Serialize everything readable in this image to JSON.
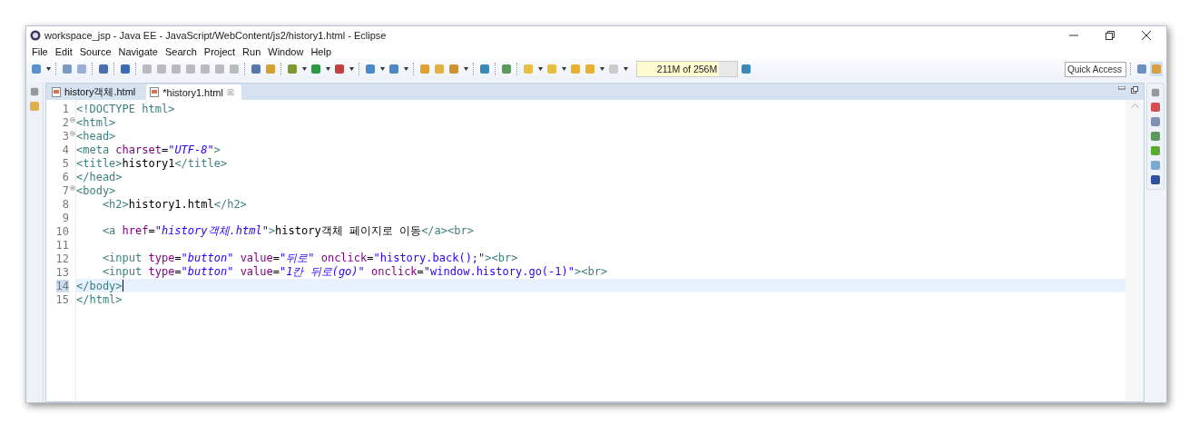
{
  "window": {
    "title": "workspace_jsp - Java EE - JavaScript/WebContent/js2/history1.html - Eclipse"
  },
  "menu": [
    "File",
    "Edit",
    "Source",
    "Navigate",
    "Search",
    "Project",
    "Run",
    "Window",
    "Help"
  ],
  "heap": {
    "reading": "211M of 256M",
    "level": 0.82
  },
  "quick_access": {
    "placeholder": "Quick Access"
  },
  "tabs": [
    {
      "label": "history객체.html",
      "selected": false
    },
    {
      "label": "*history1.html",
      "selected": true,
      "close": "☒"
    }
  ],
  "lines": [
    {
      "number": "1",
      "fold": false,
      "current": false,
      "tokens": [
        {
          "kind": "tag",
          "text": "<!DOCTYPE html>"
        }
      ]
    },
    {
      "number": "2",
      "fold": true,
      "current": false,
      "tokens": [
        {
          "kind": "tag",
          "text": "<html>"
        }
      ]
    },
    {
      "number": "3",
      "fold": true,
      "current": false,
      "tokens": [
        {
          "kind": "tag",
          "text": "<head>"
        }
      ]
    },
    {
      "number": "4",
      "fold": false,
      "current": false,
      "tokens": [
        {
          "kind": "tag",
          "text": "<meta"
        },
        {
          "kind": "attr",
          "text": " charset"
        },
        {
          "kind": "text",
          "text": "="
        },
        {
          "kind": "value",
          "text": "\"UTF-8\""
        },
        {
          "kind": "tag",
          "text": ">"
        }
      ]
    },
    {
      "number": "5",
      "fold": false,
      "current": false,
      "tokens": [
        {
          "kind": "tag",
          "text": "<title>"
        },
        {
          "kind": "text",
          "text": "history1"
        },
        {
          "kind": "tag",
          "text": "</title>"
        }
      ]
    },
    {
      "number": "6",
      "fold": false,
      "current": false,
      "tokens": [
        {
          "kind": "tag",
          "text": "</head>"
        }
      ]
    },
    {
      "number": "7",
      "fold": true,
      "current": false,
      "tokens": [
        {
          "kind": "tag",
          "text": "<body>"
        }
      ]
    },
    {
      "number": "8",
      "fold": false,
      "current": false,
      "tokens": [
        {
          "kind": "tag",
          "text": "    <h2>"
        },
        {
          "kind": "text",
          "text": "history1.html"
        },
        {
          "kind": "tag",
          "text": "</h2>"
        }
      ]
    },
    {
      "number": "9",
      "fold": false,
      "current": false
    },
    {
      "number": "10",
      "fold": false,
      "current": false,
      "tokens": [
        {
          "kind": "tag",
          "text": "    <a"
        },
        {
          "kind": "attr",
          "text": " href"
        },
        {
          "kind": "text",
          "text": "="
        },
        {
          "kind": "value",
          "text": "\"history객체.html\""
        },
        {
          "kind": "tag",
          "text": ">"
        },
        {
          "kind": "text",
          "text": "history객체 페이지로 이동"
        },
        {
          "kind": "tag",
          "text": "</a><br>"
        }
      ]
    },
    {
      "number": "11",
      "fold": false,
      "current": false
    },
    {
      "number": "12",
      "fold": false,
      "current": false,
      "tokens": [
        {
          "kind": "tag",
          "text": "    <input"
        },
        {
          "kind": "attr",
          "text": " type"
        },
        {
          "kind": "text",
          "text": "="
        },
        {
          "kind": "value",
          "text": "\"button\""
        },
        {
          "kind": "attr",
          "text": " value"
        },
        {
          "kind": "text",
          "text": "="
        },
        {
          "kind": "value",
          "text": "\"뒤로\""
        },
        {
          "kind": "attr",
          "text": " onclick"
        },
        {
          "kind": "text",
          "text": "="
        },
        {
          "kind": "script",
          "text": "\"history.back();\""
        },
        {
          "kind": "tag",
          "text": "><br>"
        }
      ]
    },
    {
      "number": "13",
      "fold": false,
      "current": false,
      "tokens": [
        {
          "kind": "tag",
          "text": "    <input"
        },
        {
          "kind": "attr",
          "text": " type"
        },
        {
          "kind": "text",
          "text": "="
        },
        {
          "kind": "value",
          "text": "\"button\""
        },
        {
          "kind": "attr",
          "text": " value"
        },
        {
          "kind": "text",
          "text": "="
        },
        {
          "kind": "value",
          "text": "\"1칸 뒤로(go)\""
        },
        {
          "kind": "attr",
          "text": " onclick"
        },
        {
          "kind": "text",
          "text": "="
        },
        {
          "kind": "script",
          "text": "\"window.history.go(-1)\""
        },
        {
          "kind": "tag",
          "text": "><br>"
        }
      ]
    },
    {
      "number": "14",
      "fold": false,
      "current": true,
      "tokens": [
        {
          "kind": "tag",
          "text": "</body>"
        }
      ]
    },
    {
      "number": "15",
      "fold": false,
      "current": false,
      "tokens": [
        {
          "kind": "tag",
          "text": "</html>"
        }
      ]
    }
  ]
}
